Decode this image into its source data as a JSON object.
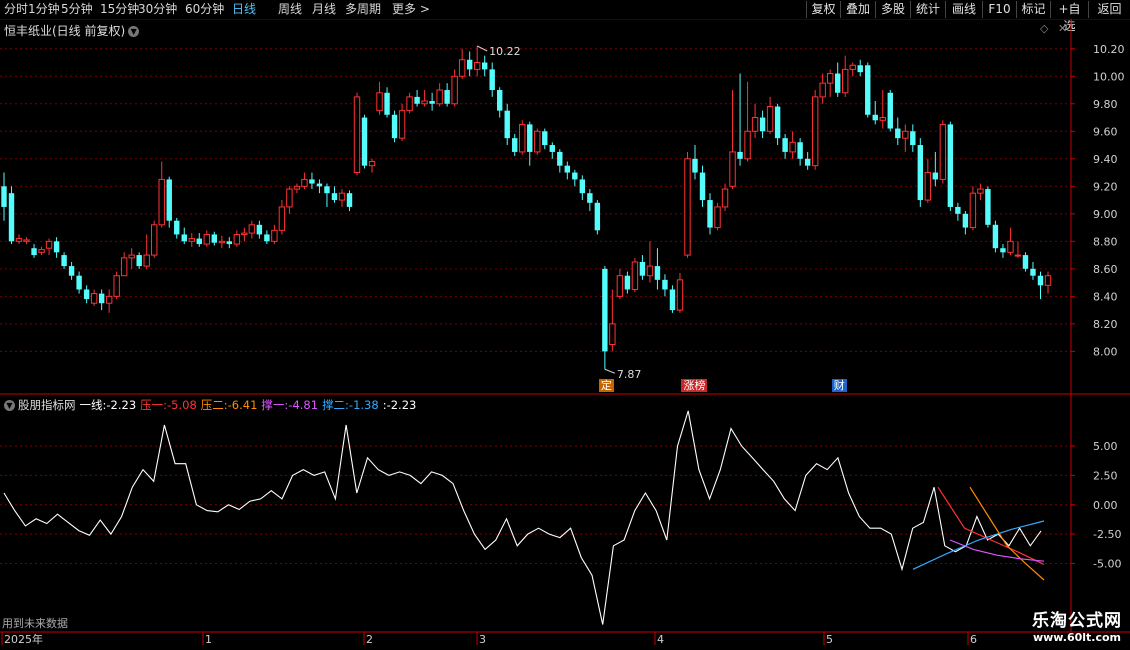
{
  "toolbar": {
    "left_items": [
      "分时",
      "1分钟",
      "5分钟",
      "15分钟",
      "30分钟",
      "60分钟",
      "日线",
      "周线",
      "月线",
      "多周期",
      "更多 >"
    ],
    "active": "日线",
    "right_items": [
      "复权",
      "叠加",
      "多股",
      "统计",
      "画线",
      "F10",
      "标记",
      "+自选",
      "返回"
    ]
  },
  "main": {
    "title": "恒丰纸业(日线 前复权)",
    "high_label": "10.22",
    "low_label": "7.87",
    "y_ticks": [
      "10.20",
      "10.00",
      "9.80",
      "9.60",
      "9.40",
      "9.20",
      "9.00",
      "8.80",
      "8.60",
      "8.40",
      "8.20",
      "8.00"
    ],
    "markers": [
      {
        "text": "定",
        "color": "#c86400"
      },
      {
        "text": "涨榜",
        "color": "#c82828"
      },
      {
        "text": "财",
        "color": "#1e64c8"
      }
    ]
  },
  "indicator": {
    "name": "股朋指标网",
    "values": [
      {
        "label": "一线:",
        "value": "-2.23",
        "color": "#ffffff"
      },
      {
        "label": "压一:",
        "value": "-5.08",
        "color": "#ff3333"
      },
      {
        "label": "压二:",
        "value": "-6.41",
        "color": "#ff8c00"
      },
      {
        "label": "撑一:",
        "value": "-4.81",
        "color": "#dd55ff"
      },
      {
        "label": "撑二:",
        "value": "-1.38",
        "color": "#33aaff"
      },
      {
        "label": ":",
        "value": "-2.23",
        "color": "#ffffff"
      }
    ],
    "y_ticks": [
      "5.00",
      "2.50",
      "0.00",
      "-2.50",
      "-5.00"
    ],
    "future_note": "用到未来数据"
  },
  "x_axis": {
    "labels": [
      "2025年",
      "1",
      "2",
      "3",
      "4",
      "5",
      "6"
    ]
  },
  "watermark": {
    "line1": "乐淘公式网",
    "line2": "www.60lt.com"
  },
  "colors": {
    "up": "#ff3232",
    "down": "#54fcfc",
    "grid": "#800000",
    "axis": "#c80000"
  },
  "chart_data": [
    {
      "type": "candlestick",
      "title": "恒丰纸业(日线 前复权)",
      "ylim": [
        7.85,
        10.3
      ],
      "candles": [
        [
          9.2,
          9.05,
          9.3,
          8.95
        ],
        [
          9.15,
          8.8,
          9.2,
          8.78
        ],
        [
          8.8,
          8.82,
          8.85,
          8.78
        ],
        [
          8.8,
          8.81,
          8.83,
          8.78
        ],
        [
          8.75,
          8.7,
          8.78,
          8.68
        ],
        [
          8.72,
          8.74,
          8.76,
          8.7
        ],
        [
          8.75,
          8.8,
          8.82,
          8.7
        ],
        [
          8.8,
          8.72,
          8.83,
          8.68
        ],
        [
          8.7,
          8.62,
          8.72,
          8.6
        ],
        [
          8.62,
          8.55,
          8.65,
          8.52
        ],
        [
          8.55,
          8.45,
          8.58,
          8.42
        ],
        [
          8.45,
          8.38,
          8.48,
          8.35
        ],
        [
          8.35,
          8.42,
          8.45,
          8.33
        ],
        [
          8.42,
          8.35,
          8.45,
          8.3
        ],
        [
          8.35,
          8.4,
          8.45,
          8.28
        ],
        [
          8.4,
          8.55,
          8.58,
          8.38
        ],
        [
          8.55,
          8.68,
          8.72,
          8.55
        ],
        [
          8.68,
          8.7,
          8.75,
          8.6
        ],
        [
          8.7,
          8.62,
          8.72,
          8.6
        ],
        [
          8.62,
          8.7,
          8.85,
          8.6
        ],
        [
          8.7,
          8.92,
          8.95,
          8.68
        ],
        [
          8.92,
          9.25,
          9.38,
          8.9
        ],
        [
          9.25,
          8.95,
          9.27,
          8.9
        ],
        [
          8.95,
          8.85,
          8.97,
          8.82
        ],
        [
          8.85,
          8.8,
          8.9,
          8.78
        ],
        [
          8.8,
          8.82,
          8.86,
          8.76
        ],
        [
          8.82,
          8.78,
          8.86,
          8.76
        ],
        [
          8.78,
          8.85,
          8.88,
          8.76
        ],
        [
          8.85,
          8.79,
          8.87,
          8.77
        ],
        [
          8.79,
          8.8,
          8.84,
          8.75
        ],
        [
          8.8,
          8.78,
          8.83,
          8.75
        ],
        [
          8.78,
          8.85,
          8.88,
          8.76
        ],
        [
          8.85,
          8.86,
          8.9,
          8.8
        ],
        [
          8.86,
          8.92,
          8.95,
          8.82
        ],
        [
          8.92,
          8.85,
          8.95,
          8.82
        ],
        [
          8.85,
          8.8,
          8.88,
          8.78
        ],
        [
          8.8,
          8.88,
          8.92,
          8.78
        ],
        [
          8.88,
          9.05,
          9.1,
          8.85
        ],
        [
          9.05,
          9.18,
          9.2,
          9.0
        ],
        [
          9.18,
          9.2,
          9.22,
          9.15
        ],
        [
          9.2,
          9.25,
          9.3,
          9.18
        ],
        [
          9.25,
          9.22,
          9.3,
          9.18
        ],
        [
          9.22,
          9.2,
          9.25,
          9.15
        ],
        [
          9.2,
          9.15,
          9.22,
          9.05
        ],
        [
          9.15,
          9.1,
          9.2,
          9.08
        ],
        [
          9.1,
          9.15,
          9.18,
          9.05
        ],
        [
          9.15,
          9.05,
          9.17,
          9.02
        ],
        [
          9.3,
          9.85,
          9.88,
          9.28
        ],
        [
          9.7,
          9.35,
          9.72,
          9.33
        ],
        [
          9.35,
          9.38,
          9.4,
          9.3
        ],
        [
          9.75,
          9.88,
          9.96,
          9.72
        ],
        [
          9.88,
          9.72,
          9.92,
          9.7
        ],
        [
          9.72,
          9.55,
          9.75,
          9.52
        ],
        [
          9.55,
          9.75,
          9.8,
          9.53
        ],
        [
          9.75,
          9.85,
          9.88,
          9.73
        ],
        [
          9.85,
          9.8,
          9.9,
          9.78
        ],
        [
          9.8,
          9.82,
          9.9,
          9.78
        ],
        [
          9.82,
          9.8,
          9.88,
          9.75
        ],
        [
          9.8,
          9.9,
          9.95,
          9.78
        ],
        [
          9.9,
          9.8,
          9.95,
          9.78
        ],
        [
          9.8,
          10.0,
          10.05,
          9.78
        ],
        [
          10.0,
          10.12,
          10.2,
          9.98
        ],
        [
          10.12,
          10.05,
          10.18,
          10.0
        ],
        [
          10.05,
          10.1,
          10.22,
          10.0
        ],
        [
          10.1,
          10.05,
          10.15,
          10.0
        ],
        [
          10.05,
          9.9,
          10.1,
          9.85
        ],
        [
          9.9,
          9.75,
          9.92,
          9.7
        ],
        [
          9.75,
          9.55,
          9.8,
          9.5
        ],
        [
          9.55,
          9.45,
          9.58,
          9.42
        ],
        [
          9.45,
          9.65,
          9.68,
          9.43
        ],
        [
          9.65,
          9.45,
          9.67,
          9.35
        ],
        [
          9.45,
          9.6,
          9.62,
          9.43
        ],
        [
          9.6,
          9.5,
          9.62,
          9.47
        ],
        [
          9.5,
          9.45,
          9.52,
          9.4
        ],
        [
          9.45,
          9.35,
          9.47,
          9.3
        ],
        [
          9.35,
          9.3,
          9.38,
          9.25
        ],
        [
          9.3,
          9.25,
          9.32,
          9.2
        ],
        [
          9.25,
          9.15,
          9.28,
          9.1
        ],
        [
          9.15,
          9.08,
          9.18,
          9.02
        ],
        [
          9.08,
          8.88,
          9.1,
          8.85
        ],
        [
          8.6,
          8.0,
          8.62,
          7.87
        ],
        [
          8.05,
          8.2,
          8.45,
          8.0
        ],
        [
          8.4,
          8.55,
          8.6,
          8.38
        ],
        [
          8.55,
          8.45,
          8.58,
          8.42
        ],
        [
          8.45,
          8.65,
          8.68,
          8.43
        ],
        [
          8.65,
          8.55,
          8.7,
          8.52
        ],
        [
          8.55,
          8.62,
          8.8,
          8.5
        ],
        [
          8.62,
          8.52,
          8.75,
          8.45
        ],
        [
          8.52,
          8.45,
          8.56,
          8.4
        ],
        [
          8.45,
          8.3,
          8.48,
          8.28
        ],
        [
          8.3,
          8.52,
          8.57,
          8.28
        ],
        [
          8.7,
          9.4,
          9.45,
          8.68
        ],
        [
          9.4,
          9.3,
          9.5,
          9.25
        ],
        [
          9.3,
          9.1,
          9.35,
          9.05
        ],
        [
          9.1,
          8.9,
          9.15,
          8.85
        ],
        [
          8.9,
          9.05,
          9.08,
          8.88
        ],
        [
          9.05,
          9.18,
          9.22,
          9.02
        ],
        [
          9.2,
          9.45,
          9.9,
          9.18
        ],
        [
          9.45,
          9.4,
          10.02,
          9.35
        ],
        [
          9.4,
          9.6,
          9.96,
          9.38
        ],
        [
          9.6,
          9.7,
          9.8,
          9.55
        ],
        [
          9.7,
          9.6,
          9.75,
          9.55
        ],
        [
          9.6,
          9.78,
          9.85,
          9.58
        ],
        [
          9.78,
          9.55,
          9.8,
          9.5
        ],
        [
          9.55,
          9.45,
          9.58,
          9.4
        ],
        [
          9.45,
          9.52,
          9.6,
          9.4
        ],
        [
          9.52,
          9.4,
          9.55,
          9.35
        ],
        [
          9.4,
          9.35,
          9.45,
          9.32
        ],
        [
          9.35,
          9.85,
          9.9,
          9.32
        ],
        [
          9.85,
          9.95,
          10.02,
          9.8
        ],
        [
          9.95,
          10.02,
          10.05,
          9.85
        ],
        [
          10.02,
          9.88,
          10.1,
          9.85
        ],
        [
          9.88,
          10.05,
          10.15,
          9.85
        ],
        [
          10.05,
          10.08,
          10.1,
          10.0
        ],
        [
          10.08,
          10.03,
          10.12,
          10.0
        ],
        [
          10.08,
          9.72,
          10.1,
          9.7
        ],
        [
          9.72,
          9.68,
          9.82,
          9.65
        ],
        [
          9.68,
          9.7,
          9.9,
          9.62
        ],
        [
          9.88,
          9.62,
          9.9,
          9.6
        ],
        [
          9.62,
          9.55,
          9.7,
          9.5
        ],
        [
          9.55,
          9.6,
          9.65,
          9.45
        ],
        [
          9.6,
          9.5,
          9.65,
          9.45
        ],
        [
          9.5,
          9.1,
          9.55,
          9.05
        ],
        [
          9.1,
          9.3,
          9.4,
          9.08
        ],
        [
          9.3,
          9.25,
          9.45,
          9.2
        ],
        [
          9.25,
          9.65,
          9.68,
          9.22
        ],
        [
          9.65,
          9.05,
          9.67,
          9.02
        ],
        [
          9.05,
          9.0,
          9.08,
          8.95
        ],
        [
          9.0,
          8.9,
          9.02,
          8.85
        ],
        [
          8.9,
          9.15,
          9.2,
          8.88
        ],
        [
          9.15,
          9.18,
          9.22,
          9.1
        ],
        [
          9.18,
          8.92,
          9.2,
          8.9
        ],
        [
          8.92,
          8.75,
          8.95,
          8.72
        ],
        [
          8.75,
          8.72,
          8.78,
          8.68
        ],
        [
          8.72,
          8.8,
          8.9,
          8.7
        ],
        [
          8.7,
          8.7,
          8.8,
          8.68
        ],
        [
          8.7,
          8.6,
          8.72,
          8.58
        ],
        [
          8.6,
          8.55,
          8.65,
          8.52
        ],
        [
          8.55,
          8.48,
          8.58,
          8.38
        ],
        [
          8.48,
          8.55,
          8.58,
          8.42
        ]
      ],
      "annotations": [
        {
          "text": "10.22",
          "type": "high"
        },
        {
          "text": "7.87",
          "type": "low"
        }
      ],
      "markers": [
        {
          "text": "定",
          "index": 80
        },
        {
          "text": "涨榜",
          "index": 91
        },
        {
          "text": "财",
          "index": 111
        }
      ]
    },
    {
      "type": "line",
      "title": "股朋指标网",
      "ylim": [
        -10.5,
        8.5
      ],
      "series": [
        {
          "name": "一线",
          "values": [
            1.0,
            -0.5,
            -1.8,
            -1.2,
            -1.6,
            -0.8,
            -1.5,
            -2.2,
            -2.6,
            -1.3,
            -2.5,
            -1.0,
            1.5,
            3.0,
            2.0,
            6.8,
            3.5,
            3.5,
            0.0,
            -0.5,
            -0.6,
            0.0,
            -0.4,
            0.3,
            0.5,
            1.2,
            0.5,
            2.5,
            3.0,
            2.5,
            2.8,
            0.5,
            6.8,
            1.0,
            4.0,
            3.0,
            2.5,
            2.8,
            2.5,
            1.8,
            2.8,
            2.5,
            1.8,
            -0.5,
            -2.5,
            -3.8,
            -3.0,
            -1.2,
            -3.5,
            -2.5,
            -2.0,
            -2.5,
            -2.8,
            -2.0,
            -4.5,
            -6.0,
            -10.2,
            -3.5,
            -3.0,
            -0.5,
            1.0,
            -0.5,
            -3.0,
            5.0,
            8.0,
            3.0,
            0.5,
            3.0,
            6.5,
            5.0,
            4.0,
            3.0,
            2.0,
            0.5,
            -0.5,
            2.5,
            3.5,
            3.0,
            4.0,
            1.0,
            -1.0,
            -2.0,
            -2.0,
            -2.5,
            -5.5,
            -2.0,
            -1.5,
            1.5,
            -3.5,
            -4.0,
            -3.5,
            -1.0,
            -3.0,
            -2.5,
            -3.5,
            -2.0,
            -3.5,
            -2.23
          ]
        },
        {
          "name": "压一",
          "values": [
            1.5,
            -2.0,
            -3.0,
            -4.0,
            -5.08
          ]
        },
        {
          "name": "压二",
          "values": [
            1.5,
            -1.0,
            -3.5,
            -5.0,
            -6.41
          ]
        },
        {
          "name": "撑一",
          "values": [
            -3.0,
            -3.8,
            -4.3,
            -4.6,
            -4.81
          ]
        },
        {
          "name": "撑二",
          "values": [
            -5.5,
            -4.2,
            -3.0,
            -2.1,
            -1.38
          ]
        }
      ]
    }
  ]
}
